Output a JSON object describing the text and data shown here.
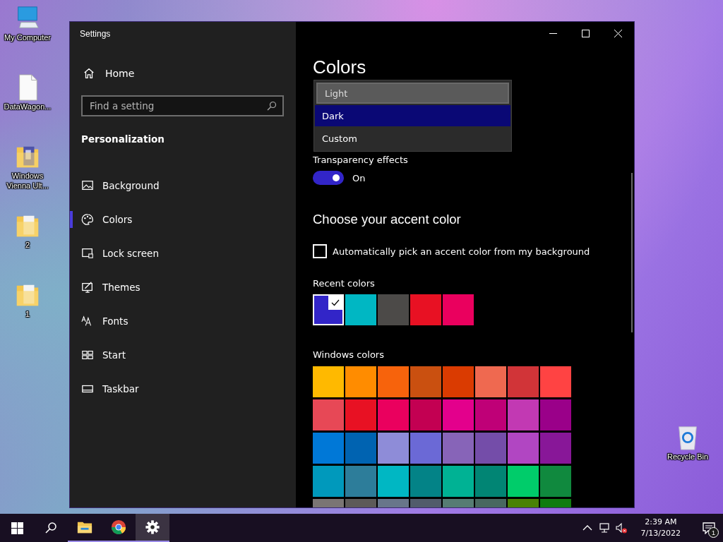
{
  "desktop_icons": [
    {
      "kind": "computer",
      "label": "My Computer"
    },
    {
      "kind": "file",
      "label": "DataWagon..."
    },
    {
      "kind": "folder-doc",
      "label": "Windows Vienna Ult..."
    },
    {
      "kind": "folder",
      "label": "2"
    },
    {
      "kind": "folder",
      "label": "1"
    }
  ],
  "recycle_bin": {
    "label": "Recycle Bin"
  },
  "window": {
    "title": "Settings"
  },
  "sidebar": {
    "home": "Home",
    "search": {
      "placeholder": "Find a setting"
    },
    "section": "Personalization",
    "items": [
      {
        "label": "Background",
        "selected": false
      },
      {
        "label": "Colors",
        "selected": true
      },
      {
        "label": "Lock screen",
        "selected": false
      },
      {
        "label": "Themes",
        "selected": false
      },
      {
        "label": "Fonts",
        "selected": false
      },
      {
        "label": "Start",
        "selected": false
      },
      {
        "label": "Taskbar",
        "selected": false
      }
    ]
  },
  "content": {
    "heading": "Colors",
    "mode_dropdown": [
      {
        "label": "Light",
        "selected": false,
        "hovered": true
      },
      {
        "label": "Dark",
        "selected": true,
        "hovered": false
      },
      {
        "label": "Custom",
        "selected": false,
        "hovered": false
      }
    ],
    "transparency": {
      "label": "Transparency effects",
      "on": true,
      "state_label": "On"
    },
    "accent_heading": "Choose your accent color",
    "auto_pick": {
      "label": "Automatically pick an accent color from my background",
      "checked": false
    },
    "recent_colors": {
      "label": "Recent colors",
      "swatches": [
        {
          "color": "#3225c8",
          "selected": true
        },
        {
          "color": "#00b7c3",
          "selected": false
        },
        {
          "color": "#4c4a48",
          "selected": false
        },
        {
          "color": "#e81123",
          "selected": false
        },
        {
          "color": "#ea005e",
          "selected": false
        }
      ]
    },
    "windows_colors": {
      "label": "Windows colors",
      "swatches": [
        {
          "color": "#ffb900"
        },
        {
          "color": "#ff8c00"
        },
        {
          "color": "#f7630c"
        },
        {
          "color": "#ca5010"
        },
        {
          "color": "#da3b01"
        },
        {
          "color": "#ef6950"
        },
        {
          "color": "#d13438"
        },
        {
          "color": "#ff4343"
        },
        {
          "color": "#e74856"
        },
        {
          "color": "#e81123"
        },
        {
          "color": "#ea005e"
        },
        {
          "color": "#c30052"
        },
        {
          "color": "#e3008c"
        },
        {
          "color": "#bf0077"
        },
        {
          "color": "#c239b3"
        },
        {
          "color": "#9a0089"
        },
        {
          "color": "#0078d7"
        },
        {
          "color": "#0063b1"
        },
        {
          "color": "#8e8cd8"
        },
        {
          "color": "#6b69d6"
        },
        {
          "color": "#8764b8"
        },
        {
          "color": "#744da9"
        },
        {
          "color": "#b146c2"
        },
        {
          "color": "#881798"
        },
        {
          "color": "#0099bc"
        },
        {
          "color": "#2d7d9a"
        },
        {
          "color": "#00b7c3"
        },
        {
          "color": "#038387"
        },
        {
          "color": "#00b294"
        },
        {
          "color": "#018574"
        },
        {
          "color": "#00cc6a"
        },
        {
          "color": "#10893e"
        },
        {
          "color": "#7a7574"
        },
        {
          "color": "#5d5a58"
        },
        {
          "color": "#68768a"
        },
        {
          "color": "#515c6b"
        },
        {
          "color": "#567c73"
        },
        {
          "color": "#486860"
        },
        {
          "color": "#498205"
        },
        {
          "color": "#107c10"
        }
      ]
    }
  },
  "taskbar": {
    "apps": [
      {
        "kind": "explorer",
        "running": true,
        "active": false
      },
      {
        "kind": "chrome",
        "running": true,
        "active": false
      },
      {
        "kind": "settings",
        "running": true,
        "active": true
      }
    ],
    "time": "2:39 AM",
    "date": "7/13/2022",
    "notifications": "1"
  }
}
